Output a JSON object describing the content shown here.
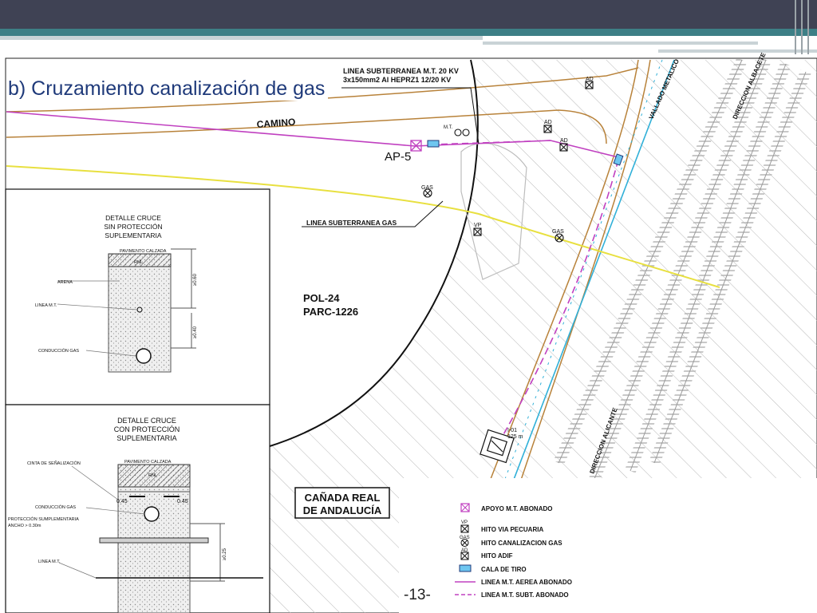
{
  "slide": {
    "title": "b) Cruzamiento canalización de gas",
    "page_number": "-13-"
  },
  "map": {
    "lines": {
      "underground_mt_l1": "LINEA SUBTERRANEA M.T. 20 KV",
      "underground_mt_l2": "3x150mm2 Al HEPRZ1 12/20 KV",
      "underground_gas": "LINEA SUBTERRANEA GAS"
    },
    "road": "CAMINO",
    "fence": "VALLADO METALICO",
    "dir_albacete": "DIRECCION ALBACETE",
    "dir_alicante": "DIRECCION ALICANTE",
    "pole": "AP-5",
    "parcel_l1": "POL-24",
    "parcel_l2": "PARC-1226",
    "canada_l1": "CAÑADA REAL",
    "canada_l2": "DE ANDALUCÍA",
    "markers": {
      "ad": "AD",
      "gas": "GAS",
      "vp": "VP",
      "mt": "M.T."
    },
    "station_l1": "I-01",
    "station_l2": "125 m"
  },
  "detail1": {
    "title_l1": "DETALLE CRUCE",
    "title_l2": "SIN PROTECCIÓN",
    "title_l3": "SUPLEMENTARIA",
    "pavement": "PAVIMENTO CALZADA",
    "fill": "RNL",
    "sand": "ARENA",
    "mt_line": "LINEA M.T.",
    "gas_pipe": "CONDUCCIÓN GAS",
    "dim1": "≥0.60",
    "dim2": "≥0.40"
  },
  "detail2": {
    "title_l1": "DETALLE CRUCE",
    "title_l2": "CON PROTECCIÓN",
    "title_l3": "SUPLEMENTARIA",
    "tape": "CINTA DE SEÑALIZACIÓN",
    "pavement": "PAVIMENTO CALZADA",
    "fill": "RNL",
    "gas_pipe": "CONDUCCIÓN GAS",
    "protection_l1": "PROTECCIÓN SUMPLEMENTARIA",
    "protection_l2": "ANCHO > 0.30m",
    "mt_line": "LINEA M.T.",
    "dim_left": "0.45",
    "dim_right": "0.45",
    "dim_v": "≥0.25"
  },
  "legend": {
    "items": [
      {
        "label": "APOYO M.T. ABONADO"
      },
      {
        "label": "HITO VIA PECUARIA",
        "tag": "VP"
      },
      {
        "label": "HITO CANALIZACION GAS",
        "tag": "GAS"
      },
      {
        "label": "HITO ADIF",
        "tag": "AD"
      },
      {
        "label": "CALA DE TIRO"
      },
      {
        "label": "LINEA M.T. AEREA ABONADO"
      },
      {
        "label": "LINEA M.T. SUBT. ABONADO"
      }
    ]
  },
  "colors": {
    "header": "#3f4254",
    "accent": "#3d7f86",
    "title": "#1f3a7a",
    "aerial_line": "#c040c0",
    "gas_line": "#e8e040",
    "road": "#b8823a",
    "rail_fence": "#30b0d8"
  }
}
